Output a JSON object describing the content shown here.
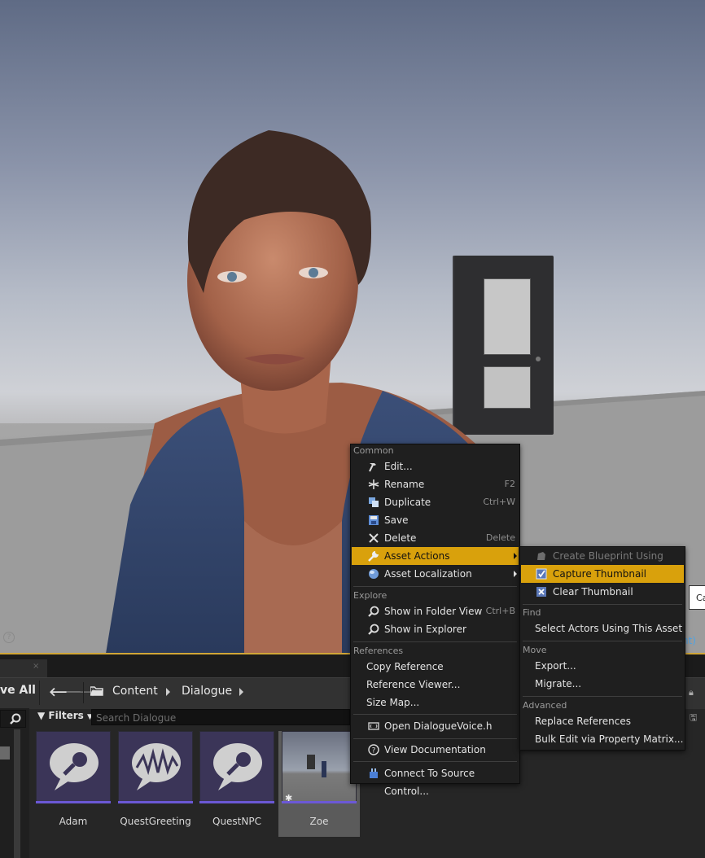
{
  "viewport": {
    "help_glyph": "?",
    "right_tooltip_text": "Ca",
    "right_edge_text": "nt)"
  },
  "content_browser": {
    "save_all_label": "ve All",
    "breadcrumb": [
      "Content",
      "Dialogue"
    ],
    "filters_label": "Filters",
    "search_placeholder": "Search Dialogue",
    "tab_close": "×",
    "assets": [
      {
        "label": "Adam",
        "icon": "dialogue-voice-icon"
      },
      {
        "label": "QuestGreeting",
        "icon": "dialogue-wave-icon"
      },
      {
        "label": "QuestNPC",
        "icon": "dialogue-voice-icon"
      },
      {
        "label": "Zoe",
        "icon": "level-thumbnail"
      }
    ],
    "accent_color": "#6b58d6"
  },
  "context_menu": {
    "highlight_color": "#d9a10c",
    "sections": {
      "common": "Common",
      "explore": "Explore",
      "references": "References"
    },
    "items": {
      "edit": {
        "label": "Edit...",
        "shortcut": ""
      },
      "rename": {
        "label": "Rename",
        "shortcut": "F2"
      },
      "duplicate": {
        "label": "Duplicate",
        "shortcut": "Ctrl+W"
      },
      "save": {
        "label": "Save",
        "shortcut": ""
      },
      "delete": {
        "label": "Delete",
        "shortcut": "Delete"
      },
      "asset_actions": {
        "label": "Asset Actions"
      },
      "asset_localization": {
        "label": "Asset Localization"
      },
      "show_in_folder_view": {
        "label": "Show in Folder View",
        "shortcut": "Ctrl+B"
      },
      "show_in_explorer": {
        "label": "Show in Explorer"
      },
      "copy_reference": {
        "label": "Copy Reference"
      },
      "reference_viewer": {
        "label": "Reference Viewer..."
      },
      "size_map": {
        "label": "Size Map..."
      },
      "open_header": {
        "label": "Open DialogueVoice.h"
      },
      "view_documentation": {
        "label": "View Documentation"
      },
      "connect_source_control": {
        "label": "Connect To Source Control..."
      }
    }
  },
  "sub_menu": {
    "sections": {
      "find": "Find",
      "move": "Move",
      "advanced": "Advanced"
    },
    "items": {
      "create_blueprint": "Create Blueprint Using This...",
      "capture_thumbnail": "Capture Thumbnail",
      "clear_thumbnail": "Clear Thumbnail",
      "select_actors": "Select Actors Using This Asset",
      "export": "Export...",
      "migrate": "Migrate...",
      "replace_references": "Replace References",
      "bulk_edit": "Bulk Edit via Property Matrix..."
    }
  }
}
